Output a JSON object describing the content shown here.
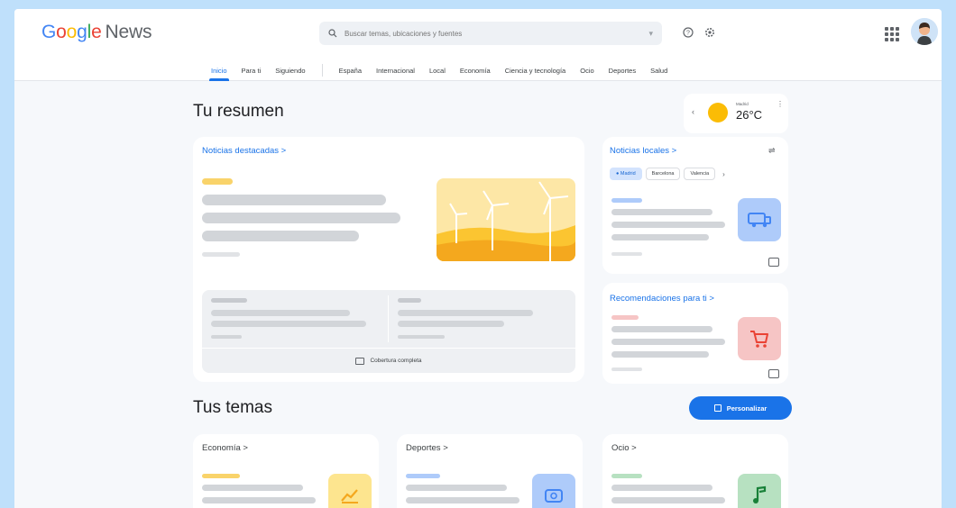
{
  "header": {
    "logo": {
      "g1": "G",
      "g2": "o",
      "g3": "o",
      "g4": "g",
      "g5": "l",
      "g6": "e",
      "product": "News"
    },
    "search_placeholder": "Buscar temas, ubicaciones y fuentes",
    "icons": [
      "search-icon",
      "help-icon",
      "settings-icon",
      "apps-grid-icon",
      "account-avatar"
    ]
  },
  "nav": {
    "tabs": [
      "Inicio",
      "Para ti",
      "Siguiendo"
    ],
    "sections": [
      "España",
      "Internacional",
      "Local",
      "Economía",
      "Ciencia y tecnología",
      "Ocio",
      "Deportes",
      "Salud"
    ],
    "active": "Inicio"
  },
  "summary": {
    "title": "Tu resumen",
    "weather": {
      "city": "Madrid",
      "temp": "26°C"
    },
    "featured": {
      "title": "Noticias destacadas",
      "coverage_label": "Cobertura completa"
    },
    "local": {
      "title": "Noticias locales",
      "chips": [
        "Madrid",
        "Barcelona",
        "Valencia"
      ]
    },
    "recommendations": {
      "title": "Recomendaciones para ti"
    }
  },
  "topics": {
    "title": "Tus temas",
    "customize_label": "Personalizar",
    "cards": [
      {
        "title": "Economía"
      },
      {
        "title": "Deportes"
      },
      {
        "title": "Ocio"
      }
    ]
  },
  "colors": {
    "accent": "#1a73e8",
    "background": "#bfe0fb",
    "placeholder_bar": "#d2d5d9",
    "economia_thumb": "#fde58f",
    "deportes_thumb": "#aecbfa",
    "ocio_thumb": "#b7e1c1",
    "local_thumb": "#aecbfa",
    "reco_thumb": "#f6c5c5"
  }
}
